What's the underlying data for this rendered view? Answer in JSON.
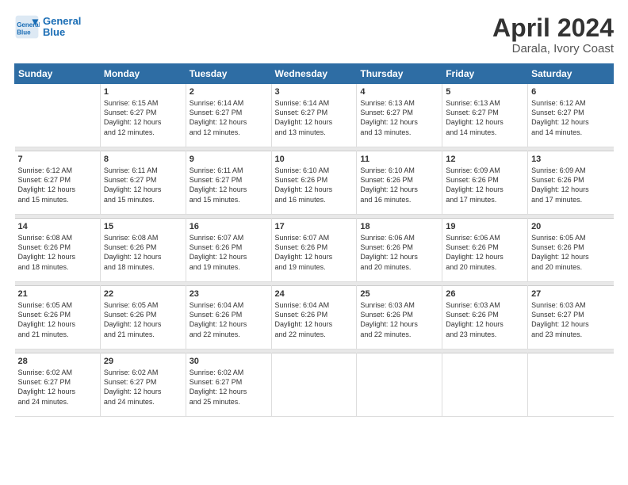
{
  "logo": {
    "line1": "General",
    "line2": "Blue"
  },
  "title": "April 2024",
  "subtitle": "Darala, Ivory Coast",
  "headers": [
    "Sunday",
    "Monday",
    "Tuesday",
    "Wednesday",
    "Thursday",
    "Friday",
    "Saturday"
  ],
  "weeks": [
    [
      {
        "day": "",
        "info": ""
      },
      {
        "day": "1",
        "info": "Sunrise: 6:15 AM\nSunset: 6:27 PM\nDaylight: 12 hours\nand 12 minutes."
      },
      {
        "day": "2",
        "info": "Sunrise: 6:14 AM\nSunset: 6:27 PM\nDaylight: 12 hours\nand 12 minutes."
      },
      {
        "day": "3",
        "info": "Sunrise: 6:14 AM\nSunset: 6:27 PM\nDaylight: 12 hours\nand 13 minutes."
      },
      {
        "day": "4",
        "info": "Sunrise: 6:13 AM\nSunset: 6:27 PM\nDaylight: 12 hours\nand 13 minutes."
      },
      {
        "day": "5",
        "info": "Sunrise: 6:13 AM\nSunset: 6:27 PM\nDaylight: 12 hours\nand 14 minutes."
      },
      {
        "day": "6",
        "info": "Sunrise: 6:12 AM\nSunset: 6:27 PM\nDaylight: 12 hours\nand 14 minutes."
      }
    ],
    [
      {
        "day": "7",
        "info": "Sunrise: 6:12 AM\nSunset: 6:27 PM\nDaylight: 12 hours\nand 15 minutes."
      },
      {
        "day": "8",
        "info": "Sunrise: 6:11 AM\nSunset: 6:27 PM\nDaylight: 12 hours\nand 15 minutes."
      },
      {
        "day": "9",
        "info": "Sunrise: 6:11 AM\nSunset: 6:27 PM\nDaylight: 12 hours\nand 15 minutes."
      },
      {
        "day": "10",
        "info": "Sunrise: 6:10 AM\nSunset: 6:26 PM\nDaylight: 12 hours\nand 16 minutes."
      },
      {
        "day": "11",
        "info": "Sunrise: 6:10 AM\nSunset: 6:26 PM\nDaylight: 12 hours\nand 16 minutes."
      },
      {
        "day": "12",
        "info": "Sunrise: 6:09 AM\nSunset: 6:26 PM\nDaylight: 12 hours\nand 17 minutes."
      },
      {
        "day": "13",
        "info": "Sunrise: 6:09 AM\nSunset: 6:26 PM\nDaylight: 12 hours\nand 17 minutes."
      }
    ],
    [
      {
        "day": "14",
        "info": "Sunrise: 6:08 AM\nSunset: 6:26 PM\nDaylight: 12 hours\nand 18 minutes."
      },
      {
        "day": "15",
        "info": "Sunrise: 6:08 AM\nSunset: 6:26 PM\nDaylight: 12 hours\nand 18 minutes."
      },
      {
        "day": "16",
        "info": "Sunrise: 6:07 AM\nSunset: 6:26 PM\nDaylight: 12 hours\nand 19 minutes."
      },
      {
        "day": "17",
        "info": "Sunrise: 6:07 AM\nSunset: 6:26 PM\nDaylight: 12 hours\nand 19 minutes."
      },
      {
        "day": "18",
        "info": "Sunrise: 6:06 AM\nSunset: 6:26 PM\nDaylight: 12 hours\nand 20 minutes."
      },
      {
        "day": "19",
        "info": "Sunrise: 6:06 AM\nSunset: 6:26 PM\nDaylight: 12 hours\nand 20 minutes."
      },
      {
        "day": "20",
        "info": "Sunrise: 6:05 AM\nSunset: 6:26 PM\nDaylight: 12 hours\nand 20 minutes."
      }
    ],
    [
      {
        "day": "21",
        "info": "Sunrise: 6:05 AM\nSunset: 6:26 PM\nDaylight: 12 hours\nand 21 minutes."
      },
      {
        "day": "22",
        "info": "Sunrise: 6:05 AM\nSunset: 6:26 PM\nDaylight: 12 hours\nand 21 minutes."
      },
      {
        "day": "23",
        "info": "Sunrise: 6:04 AM\nSunset: 6:26 PM\nDaylight: 12 hours\nand 22 minutes."
      },
      {
        "day": "24",
        "info": "Sunrise: 6:04 AM\nSunset: 6:26 PM\nDaylight: 12 hours\nand 22 minutes."
      },
      {
        "day": "25",
        "info": "Sunrise: 6:03 AM\nSunset: 6:26 PM\nDaylight: 12 hours\nand 22 minutes."
      },
      {
        "day": "26",
        "info": "Sunrise: 6:03 AM\nSunset: 6:26 PM\nDaylight: 12 hours\nand 23 minutes."
      },
      {
        "day": "27",
        "info": "Sunrise: 6:03 AM\nSunset: 6:27 PM\nDaylight: 12 hours\nand 23 minutes."
      }
    ],
    [
      {
        "day": "28",
        "info": "Sunrise: 6:02 AM\nSunset: 6:27 PM\nDaylight: 12 hours\nand 24 minutes."
      },
      {
        "day": "29",
        "info": "Sunrise: 6:02 AM\nSunset: 6:27 PM\nDaylight: 12 hours\nand 24 minutes."
      },
      {
        "day": "30",
        "info": "Sunrise: 6:02 AM\nSunset: 6:27 PM\nDaylight: 12 hours\nand 25 minutes."
      },
      {
        "day": "",
        "info": ""
      },
      {
        "day": "",
        "info": ""
      },
      {
        "day": "",
        "info": ""
      },
      {
        "day": "",
        "info": ""
      }
    ]
  ]
}
